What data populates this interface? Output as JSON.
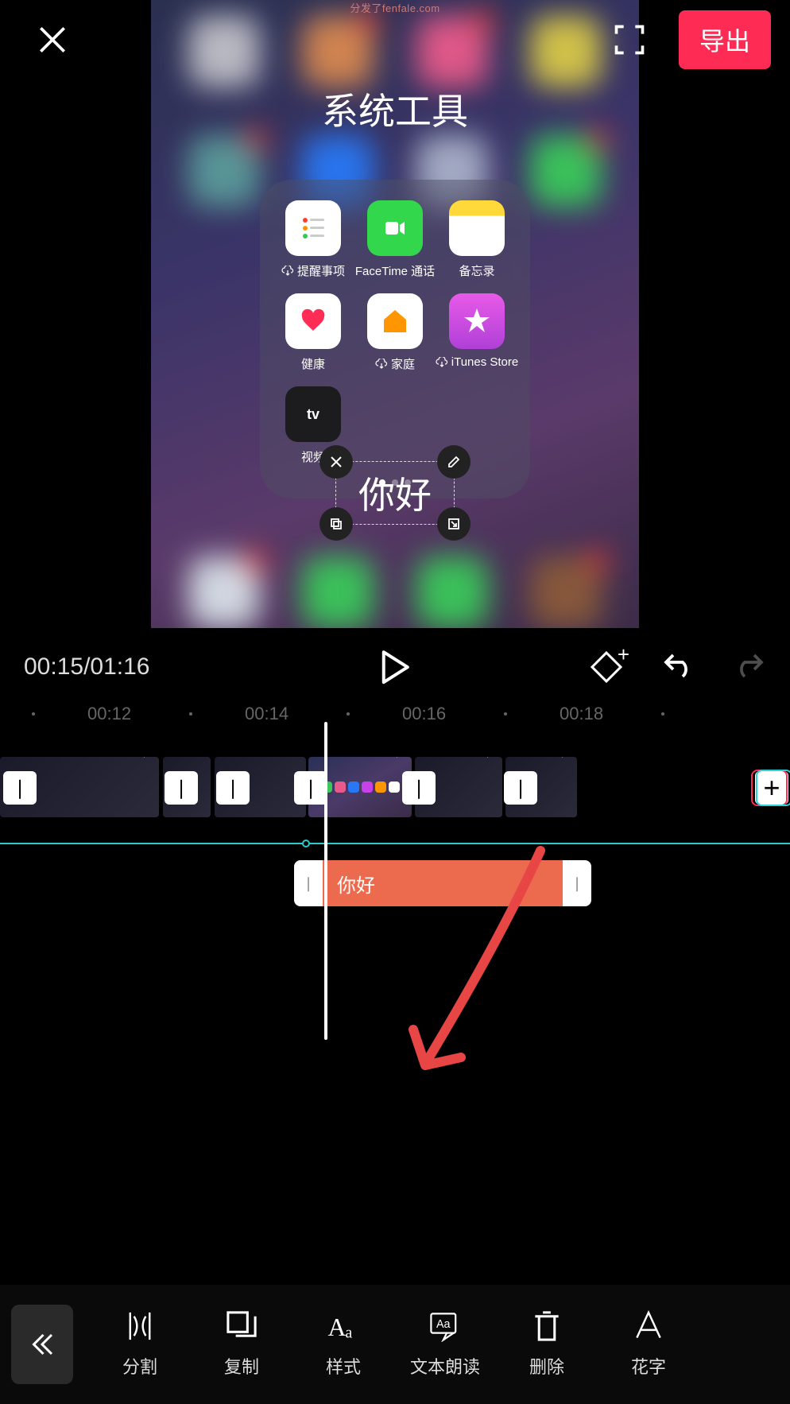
{
  "watermark": "分发了fenfale.com",
  "header": {
    "export_label": "导出"
  },
  "preview": {
    "folder_title": "系统工具",
    "apps": [
      {
        "label": "提醒事项",
        "cloud": true,
        "bg": "#ffffff"
      },
      {
        "label": "FaceTime 通话",
        "cloud": false,
        "bg": "#32d74b"
      },
      {
        "label": "备忘录",
        "cloud": false,
        "bg": "#ffffff"
      },
      {
        "label": "健康",
        "cloud": false,
        "bg": "#ffffff"
      },
      {
        "label": "家庭",
        "cloud": true,
        "bg": "#ffffff"
      },
      {
        "label": "iTunes Store",
        "cloud": true,
        "bg": "#c642e8"
      },
      {
        "label": "视频",
        "cloud": false,
        "bg": "#1c1c1e"
      }
    ],
    "text_overlay": "你好"
  },
  "playback": {
    "current_time": "00:15",
    "total_time": "01:16"
  },
  "ruler": {
    "ticks": [
      "00:12",
      "00:14",
      "00:16",
      "00:18"
    ]
  },
  "text_track": {
    "label": "你好"
  },
  "toolbar": {
    "items": [
      {
        "id": "split",
        "label": "分割"
      },
      {
        "id": "copy",
        "label": "复制"
      },
      {
        "id": "style",
        "label": "样式"
      },
      {
        "id": "tts",
        "label": "文本朗读"
      },
      {
        "id": "delete",
        "label": "删除"
      },
      {
        "id": "fancy",
        "label": "花字"
      }
    ]
  }
}
